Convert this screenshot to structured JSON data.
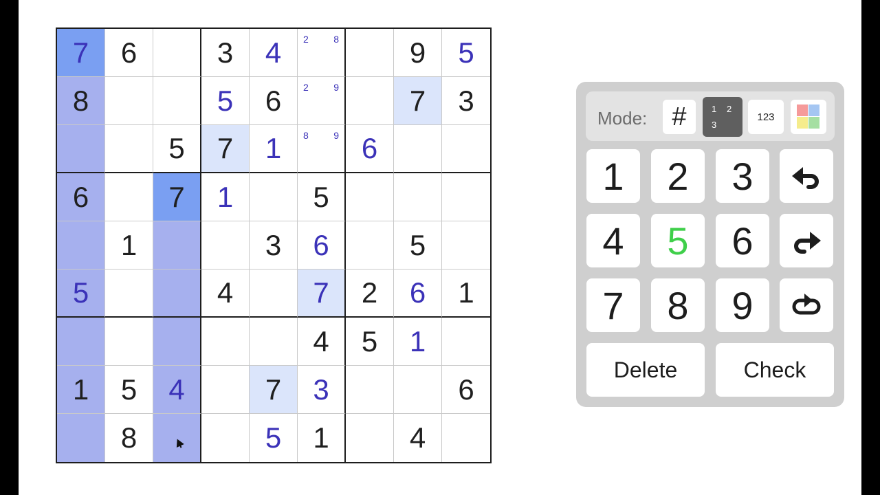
{
  "board": {
    "rows": [
      [
        {
          "v": "7",
          "t": "user",
          "hl": "strong"
        },
        {
          "v": "6",
          "t": "given"
        },
        {
          "v": ""
        },
        {
          "v": "3",
          "t": "given"
        },
        {
          "v": "4",
          "t": "user"
        },
        {
          "notes": [
            "2",
            "8"
          ]
        },
        {
          "v": ""
        },
        {
          "v": "9",
          "t": "given"
        },
        {
          "v": "5",
          "t": "user"
        }
      ],
      [
        {
          "v": "8",
          "t": "given",
          "hl": "col"
        },
        {
          "v": ""
        },
        {
          "v": ""
        },
        {
          "v": "5",
          "t": "user"
        },
        {
          "v": "6",
          "t": "given"
        },
        {
          "notes": [
            "2",
            "9"
          ]
        },
        {
          "v": ""
        },
        {
          "v": "7",
          "t": "given",
          "hl": "soft"
        },
        {
          "v": "3",
          "t": "given"
        }
      ],
      [
        {
          "v": "",
          "hl": "col"
        },
        {
          "v": ""
        },
        {
          "v": "5",
          "t": "given"
        },
        {
          "v": "7",
          "t": "given",
          "hl": "soft"
        },
        {
          "v": "1",
          "t": "user"
        },
        {
          "notes": [
            "8",
            "9"
          ]
        },
        {
          "v": "6",
          "t": "user"
        },
        {
          "v": ""
        },
        {
          "v": ""
        }
      ],
      [
        {
          "v": "6",
          "t": "given",
          "hl": "col"
        },
        {
          "v": ""
        },
        {
          "v": "7",
          "t": "given",
          "hl": "strong"
        },
        {
          "v": "1",
          "t": "user"
        },
        {
          "v": ""
        },
        {
          "v": "5",
          "t": "given"
        },
        {
          "v": ""
        },
        {
          "v": ""
        },
        {
          "v": ""
        }
      ],
      [
        {
          "v": "",
          "hl": "col"
        },
        {
          "v": "1",
          "t": "given"
        },
        {
          "v": "",
          "hl": "col"
        },
        {
          "v": ""
        },
        {
          "v": "3",
          "t": "given"
        },
        {
          "v": "6",
          "t": "user"
        },
        {
          "v": ""
        },
        {
          "v": "5",
          "t": "given"
        },
        {
          "v": ""
        }
      ],
      [
        {
          "v": "5",
          "t": "user",
          "hl": "col"
        },
        {
          "v": ""
        },
        {
          "v": "",
          "hl": "col"
        },
        {
          "v": "4",
          "t": "given"
        },
        {
          "v": ""
        },
        {
          "v": "7",
          "t": "user",
          "hl": "soft"
        },
        {
          "v": "2",
          "t": "given"
        },
        {
          "v": "6",
          "t": "user"
        },
        {
          "v": "1",
          "t": "given"
        }
      ],
      [
        {
          "v": "",
          "hl": "col"
        },
        {
          "v": ""
        },
        {
          "v": "",
          "hl": "col"
        },
        {
          "v": ""
        },
        {
          "v": ""
        },
        {
          "v": "4",
          "t": "given"
        },
        {
          "v": "5",
          "t": "given"
        },
        {
          "v": "1",
          "t": "user"
        },
        {
          "v": ""
        }
      ],
      [
        {
          "v": "1",
          "t": "given",
          "hl": "col"
        },
        {
          "v": "5",
          "t": "given"
        },
        {
          "v": "4",
          "t": "user",
          "hl": "col"
        },
        {
          "v": ""
        },
        {
          "v": "7",
          "t": "given",
          "hl": "soft"
        },
        {
          "v": "3",
          "t": "user"
        },
        {
          "v": ""
        },
        {
          "v": ""
        },
        {
          "v": "6",
          "t": "given"
        }
      ],
      [
        {
          "v": "",
          "hl": "col"
        },
        {
          "v": "8",
          "t": "given"
        },
        {
          "v": "",
          "hl": "col",
          "cursor": true
        },
        {
          "v": ""
        },
        {
          "v": "5",
          "t": "user"
        },
        {
          "v": "1",
          "t": "given"
        },
        {
          "v": ""
        },
        {
          "v": "4",
          "t": "given"
        },
        {
          "v": ""
        }
      ]
    ],
    "colors": {
      "given": "#1f1f1f",
      "user": "#3b32b8",
      "col": "#a6b0ee",
      "strong": "#7a9ff2",
      "soft": "#dbe5fb"
    }
  },
  "panel": {
    "mode_label": "Mode:",
    "mode_number_symbol": "#",
    "mode_notes_digits": [
      "1",
      "2",
      "3"
    ],
    "mode_candidates_label": "123",
    "mode_color_swatches": [
      "#f59a9a",
      "#a5c6f2",
      "#f5ec8c",
      "#a5dfa2"
    ],
    "keys": [
      "1",
      "2",
      "3",
      "4",
      "5",
      "6",
      "7",
      "8",
      "9"
    ],
    "highlight_key": "5",
    "highlight_color": "#3fcf4a",
    "icons": [
      "undo-icon",
      "redo-icon",
      "restart-icon"
    ],
    "delete_label": "Delete",
    "check_label": "Check"
  }
}
